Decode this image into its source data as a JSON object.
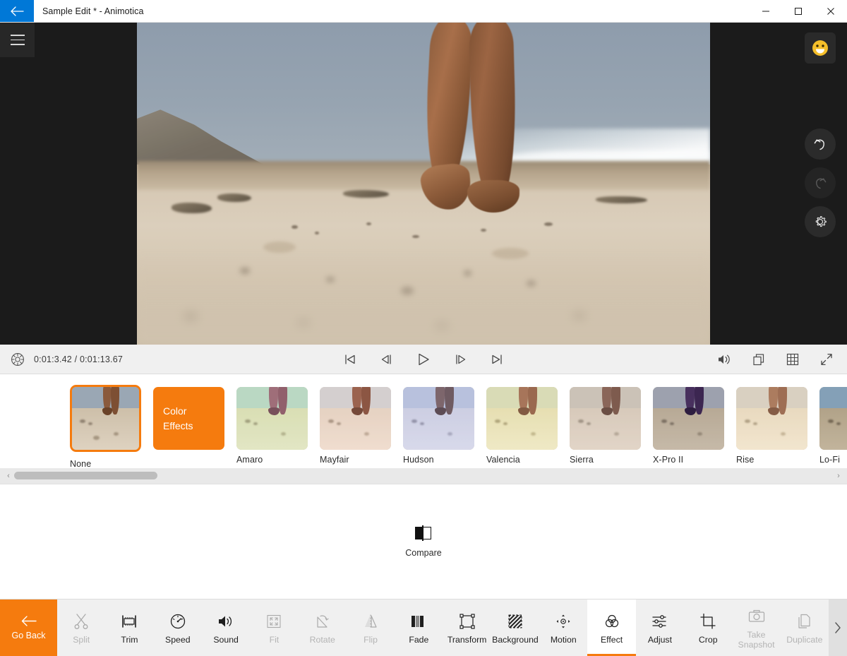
{
  "window": {
    "title": "Sample Edit * - Animotica",
    "back_button": "back-arrow",
    "minimize": "—",
    "maximize": "□",
    "close": "✕"
  },
  "preview": {
    "menu_icon": "hamburger-menu",
    "scene_description": "Close-up of bare legs walking on sandy beach with ocean surf and rocky cliff",
    "side_tools": [
      {
        "name": "feedback-emoji",
        "icon": "smiley-face",
        "enabled": true
      },
      {
        "name": "undo",
        "icon": "undo-arrow",
        "enabled": true
      },
      {
        "name": "redo",
        "icon": "redo-arrow",
        "enabled": false
      },
      {
        "name": "settings",
        "icon": "gear",
        "enabled": true
      }
    ]
  },
  "playback": {
    "settings_icon": "aperture-icon",
    "current_time": "0:01:3.42",
    "separator": "/",
    "total_time": "0:01:13.67",
    "timecode": "0:01:3.42 / 0:01:13.67",
    "transport": [
      {
        "name": "skip-to-start",
        "label": "Skip to start"
      },
      {
        "name": "step-backward",
        "label": "Previous frame"
      },
      {
        "name": "play",
        "label": "Play"
      },
      {
        "name": "step-forward",
        "label": "Next frame"
      },
      {
        "name": "skip-to-end",
        "label": "Skip to end"
      }
    ],
    "right_tools": [
      {
        "name": "volume",
        "label": "Volume"
      },
      {
        "name": "duplicate-view",
        "label": "Duplicate view"
      },
      {
        "name": "grid",
        "label": "Grid"
      },
      {
        "name": "fullscreen",
        "label": "Fullscreen"
      }
    ]
  },
  "filters": {
    "selected": "None",
    "color_effects_tile": {
      "line1": "Color",
      "line2": "Effects"
    },
    "items": [
      {
        "label": "None",
        "selected": true,
        "sky": "#9aa7b4",
        "sand": "#d9cdbb",
        "leg": "#8a5a3c",
        "overlay": "rgba(0,0,0,0)"
      },
      {
        "label": "Amaro",
        "selected": false,
        "sky": "#bcd8c8",
        "sand": "#e6e5c2",
        "leg": "#9c5c72",
        "overlay": "rgba(180,220,170,0.14)"
      },
      {
        "label": "Mayfair",
        "selected": false,
        "sky": "#cfd2d4",
        "sand": "#e8dbcd",
        "leg": "#8e5742",
        "overlay": "rgba(255,190,170,0.12)"
      },
      {
        "label": "Hudson",
        "selected": false,
        "sky": "#c2c9e0",
        "sand": "#e0ddea",
        "leg": "#7a5a56",
        "overlay": "rgba(140,160,210,0.18)"
      },
      {
        "label": "Valencia",
        "selected": false,
        "sky": "#d7dbbe",
        "sand": "#eee6c4",
        "leg": "#9a5f4e",
        "overlay": "rgba(230,220,150,0.18)"
      },
      {
        "label": "Sierra",
        "selected": false,
        "sky": "#cfc8c0",
        "sand": "#e4d9cd",
        "leg": "#7e564a",
        "overlay": "rgba(190,170,150,0.20)"
      },
      {
        "label": "X-Pro II",
        "selected": false,
        "sky": "#b0b9bf",
        "sand": "#ddd2b2",
        "leg": "#4a3360",
        "overlay": "rgba(60,40,90,0.16)"
      },
      {
        "label": "Rise",
        "selected": false,
        "sky": "#d2cec6",
        "sand": "#e9dfcd",
        "leg": "#9d6a52",
        "overlay": "rgba(255,215,170,0.16)"
      },
      {
        "label": "Lo-Fi",
        "selected": false,
        "sky": "#93b3cc",
        "sand": "#d3c4a8",
        "leg": "#6b4029",
        "overlay": "rgba(0,0,0,0.10)"
      }
    ],
    "scroll_left": "‹",
    "scroll_right": "›"
  },
  "compare": {
    "label": "Compare",
    "icon": "split-compare-icon"
  },
  "toolbar": {
    "go_back": {
      "label": "Go Back",
      "icon": "back-arrow"
    },
    "scroll_more": "›",
    "items": [
      {
        "label": "Split",
        "icon": "scissors-icon",
        "enabled": false,
        "active": false
      },
      {
        "label": "Trim",
        "icon": "trim-icon",
        "enabled": true,
        "active": false
      },
      {
        "label": "Speed",
        "icon": "speedometer-icon",
        "enabled": true,
        "active": false
      },
      {
        "label": "Sound",
        "icon": "speaker-icon",
        "enabled": true,
        "active": false
      },
      {
        "label": "Fit",
        "icon": "fit-icon",
        "enabled": false,
        "active": false
      },
      {
        "label": "Rotate",
        "icon": "rotate-icon",
        "enabled": false,
        "active": false
      },
      {
        "label": "Flip",
        "icon": "flip-icon",
        "enabled": false,
        "active": false
      },
      {
        "label": "Fade",
        "icon": "fade-icon",
        "enabled": true,
        "active": false
      },
      {
        "label": "Transform",
        "icon": "transform-icon",
        "enabled": true,
        "active": false
      },
      {
        "label": "Background",
        "icon": "background-icon",
        "enabled": true,
        "active": false
      },
      {
        "label": "Motion",
        "icon": "motion-icon",
        "enabled": true,
        "active": false
      },
      {
        "label": "Effect",
        "icon": "effect-icon",
        "enabled": true,
        "active": true
      },
      {
        "label": "Adjust",
        "icon": "sliders-icon",
        "enabled": true,
        "active": false
      },
      {
        "label": "Crop",
        "icon": "crop-icon",
        "enabled": true,
        "active": false
      },
      {
        "label": "Take\nSnapshot",
        "icon": "camera-icon",
        "enabled": false,
        "active": false
      },
      {
        "label": "Duplicate",
        "icon": "copy-icon",
        "enabled": false,
        "active": false
      }
    ]
  },
  "colors": {
    "accent": "#f57b0e",
    "titlebar_blue": "#0078d7",
    "panel": "#f0f0f0",
    "preview_bg": "#1b1b1b"
  }
}
